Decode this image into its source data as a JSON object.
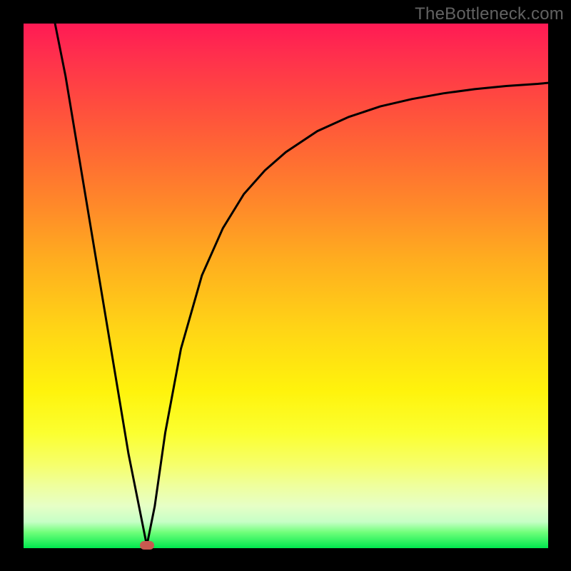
{
  "watermark": "TheBottleneck.com",
  "chart_data": {
    "type": "line",
    "title": "",
    "xlabel": "",
    "ylabel": "",
    "xrange": [
      0,
      100
    ],
    "yrange": [
      0,
      100
    ],
    "series": [
      {
        "name": "curve",
        "x": [
          6,
          8,
          10,
          12,
          14,
          16,
          18,
          20,
          22,
          23.5,
          25,
          27,
          30,
          34,
          38,
          42,
          46,
          50,
          56,
          62,
          68,
          74,
          80,
          86,
          92,
          98,
          100
        ],
        "y": [
          100,
          90,
          78,
          66,
          54,
          42,
          30,
          18,
          8,
          0.5,
          8,
          22,
          38,
          52,
          61,
          67.5,
          72,
          75.5,
          79.5,
          82.2,
          84.2,
          85.6,
          86.7,
          87.5,
          88.1,
          88.5,
          88.7
        ]
      }
    ],
    "marker": {
      "x": 23.5,
      "y": 0.5,
      "color": "#c85a50"
    },
    "gradient_stops": [
      {
        "pos": 0,
        "color": "#ff1a54"
      },
      {
        "pos": 50,
        "color": "#ffad1f"
      },
      {
        "pos": 78,
        "color": "#fbff2f"
      },
      {
        "pos": 100,
        "color": "#00e84e"
      }
    ]
  }
}
